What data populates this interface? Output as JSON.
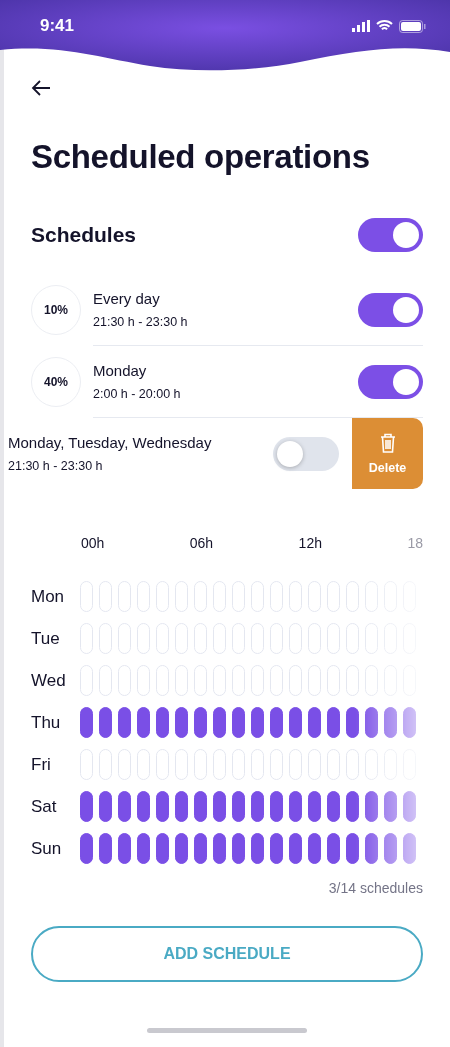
{
  "status_bar": {
    "time": "9:41"
  },
  "title": "Scheduled operations",
  "schedules": {
    "label": "Schedules",
    "on": true
  },
  "items": [
    {
      "percent": "10%",
      "name": "Every day",
      "time": "21:30 h - 23:30 h",
      "on": true,
      "swiped": false
    },
    {
      "percent": "40%",
      "name": "Monday",
      "time": "2:00 h - 20:00 h",
      "on": true,
      "swiped": false
    },
    {
      "name": "Monday, Tuesday, Wednesday",
      "time": "21:30 h - 23:30 h",
      "on": false,
      "swiped": true,
      "action": "Delete"
    }
  ],
  "hours": [
    "00h",
    "06h",
    "12h",
    "18"
  ],
  "days": [
    {
      "label": "Mon",
      "active": false
    },
    {
      "label": "Tue",
      "active": false
    },
    {
      "label": "Wed",
      "active": false
    },
    {
      "label": "Thu",
      "active": true
    },
    {
      "label": "Fri",
      "active": false
    },
    {
      "label": "Sat",
      "active": true
    },
    {
      "label": "Sun",
      "active": true
    }
  ],
  "count": "3/14 schedules",
  "add_button": "ADD SCHEDULE"
}
